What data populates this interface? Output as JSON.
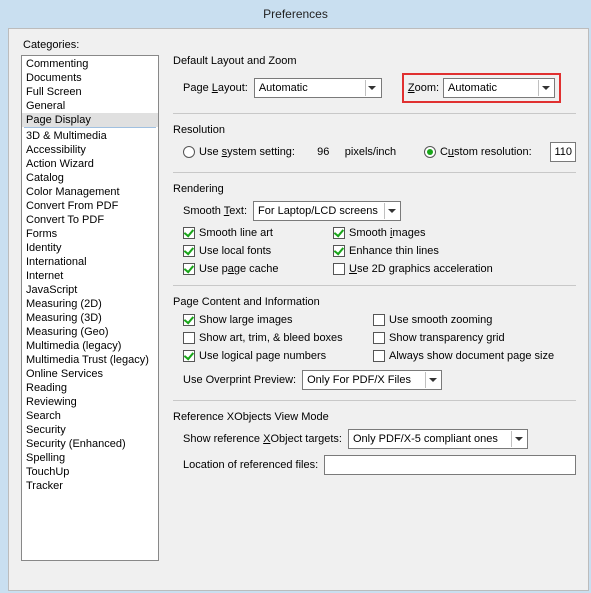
{
  "window": {
    "title": "Preferences"
  },
  "sidebar": {
    "label": "Categories:",
    "group1": [
      "Commenting",
      "Documents",
      "Full Screen",
      "General",
      "Page Display"
    ],
    "group2": [
      "3D & Multimedia",
      "Accessibility",
      "Action Wizard",
      "Catalog",
      "Color Management",
      "Convert From PDF",
      "Convert To PDF",
      "Forms",
      "Identity",
      "International",
      "Internet",
      "JavaScript",
      "Measuring (2D)",
      "Measuring (3D)",
      "Measuring (Geo)",
      "Multimedia (legacy)",
      "Multimedia Trust (legacy)",
      "Online Services",
      "Reading",
      "Reviewing",
      "Search",
      "Security",
      "Security (Enhanced)",
      "Spelling",
      "TouchUp",
      "Tracker"
    ],
    "selected": "Page Display"
  },
  "layout": {
    "group": "Default Layout and Zoom",
    "page_layout_label_pre": "Page ",
    "page_layout_label_u": "L",
    "page_layout_label_post": "ayout:",
    "page_layout_value": "Automatic",
    "zoom_label_u": "Z",
    "zoom_label_post": "oom:",
    "zoom_value": "Automatic"
  },
  "resolution": {
    "group": "Resolution",
    "sys_pre": "Use ",
    "sys_u": "s",
    "sys_post": "ystem setting:",
    "sys_value": "96",
    "unit": "pixels/inch",
    "custom_pre": "C",
    "custom_u": "u",
    "custom_post": "stom resolution:",
    "custom_value": "110"
  },
  "rendering": {
    "group": "Rendering",
    "smooth_text_pre": "Smooth ",
    "smooth_text_u": "T",
    "smooth_text_post": "ext:",
    "smooth_text_value": "For Laptop/LCD screens",
    "line_art": "Smooth line art",
    "images_pre": "Smooth ",
    "images_u": "i",
    "images_post": "mages",
    "local_fonts": "Use local fonts",
    "enhance_thin": "Enhance thin lines",
    "page_cache_pre": "Use p",
    "page_cache_u": "a",
    "page_cache_post": "ge cache",
    "gpu_pre": "",
    "gpu_u": "U",
    "gpu_post": "se 2D graphics acceleration"
  },
  "content": {
    "group": "Page Content and Information",
    "large_images": "Show large images",
    "smooth_zoom": "Use smooth zooming",
    "art_trim": "Show art, trim, & bleed boxes",
    "trans_grid": "Show transparency grid",
    "logical_pages": "Use logical page numbers",
    "doc_size": "Always show document page size",
    "overprint_label": "Use Overprint Preview:",
    "overprint_value": "Only For PDF/X Files"
  },
  "xobjects": {
    "group": "Reference XObjects View Mode",
    "targets_pre": "Show reference ",
    "targets_u": "X",
    "targets_post": "Object targets:",
    "targets_value": "Only PDF/X-5 compliant ones",
    "location_label": "Location of referenced files:"
  }
}
